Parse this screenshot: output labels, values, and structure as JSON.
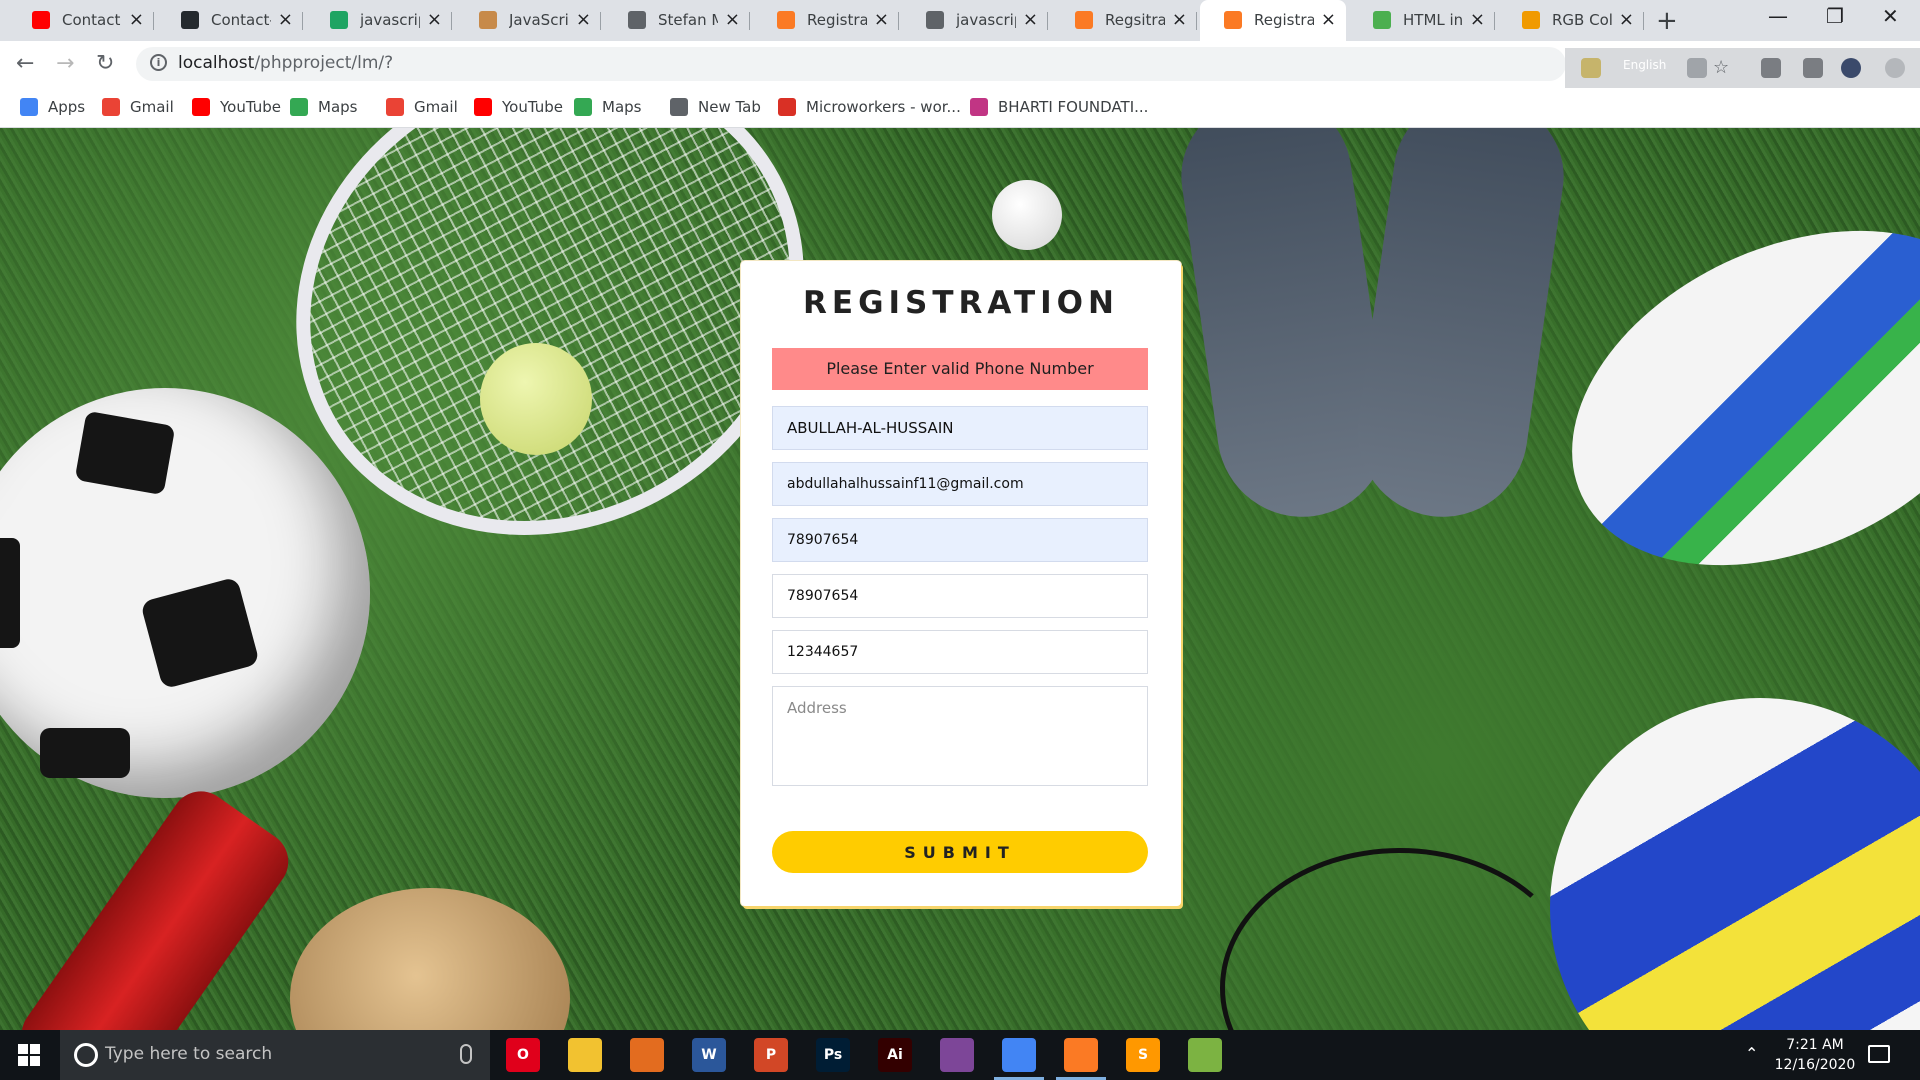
{
  "browser": {
    "tabs": [
      {
        "title": "Contact U",
        "icon": "youtube-icon",
        "color": "#ff0000"
      },
      {
        "title": "Contact-u",
        "icon": "github-icon",
        "color": "#24292e"
      },
      {
        "title": "javascript",
        "icon": "google-drive-icon",
        "color": "#1fa463"
      },
      {
        "title": "JavaScript",
        "icon": "person-avatar-icon",
        "color": "#c78a4a"
      },
      {
        "title": "Stefan Mis",
        "icon": "globe-icon",
        "color": "#5f6368"
      },
      {
        "title": "Registratio",
        "icon": "xampp-icon",
        "color": "#fb7a24"
      },
      {
        "title": "javascript",
        "icon": "globe-icon",
        "color": "#5f6368"
      },
      {
        "title": "Regsitratio",
        "icon": "xampp-icon",
        "color": "#fb7a24"
      },
      {
        "title": "Registratio",
        "icon": "xampp-icon",
        "color": "#fb7a24",
        "active": true
      },
      {
        "title": "HTML inp",
        "icon": "w3schools-icon",
        "color": "#4caf50"
      },
      {
        "title": "RGB Color",
        "icon": "r-logo-icon",
        "color": "#f09a00"
      }
    ],
    "new_tab_label": "+",
    "url_host": "localhost",
    "url_path": "/phpproject/lm/?",
    "extension_language": "English"
  },
  "bookmarks": [
    {
      "label": "Apps",
      "icon": "apps-grid-icon",
      "color": "#4285f4"
    },
    {
      "label": "Gmail",
      "icon": "gmail-icon",
      "color": "#ea4335"
    },
    {
      "label": "YouTube",
      "icon": "youtube-icon",
      "color": "#ff0000"
    },
    {
      "label": "Maps",
      "icon": "maps-pin-icon",
      "color": "#34a853"
    },
    {
      "label": "Gmail",
      "icon": "gmail-icon",
      "color": "#ea4335"
    },
    {
      "label": "YouTube",
      "icon": "youtube-icon",
      "color": "#ff0000"
    },
    {
      "label": "Maps",
      "icon": "maps-pin-icon",
      "color": "#34a853"
    },
    {
      "label": "New Tab",
      "icon": "globe-icon",
      "color": "#5f6368"
    },
    {
      "label": "Microworkers - wor...",
      "icon": "microworkers-icon",
      "color": "#d93025"
    },
    {
      "label": "BHARTI FOUNDATI...",
      "icon": "instagram-icon",
      "color": "#c13584"
    }
  ],
  "form": {
    "title": "REGISTRATION",
    "alert": "Please Enter valid Phone Number",
    "name_value": "ABULLAH-AL-HUSSAIN",
    "email_value": "abdullahalhussainf11@gmail.com",
    "phone_value": "78907654",
    "phone_confirm_value": "78907654",
    "number_value": "12344657",
    "address_placeholder": "Address",
    "submit_label": "SUBMIT",
    "accent_color": "#ffcc00",
    "alert_color": "#ff8a8a"
  },
  "taskbar": {
    "search_placeholder": "Type here to search",
    "apps": [
      {
        "icon": "opera-icon",
        "label": "O",
        "color": "#e0001b"
      },
      {
        "icon": "file-explorer-icon",
        "label": "",
        "color": "#f2c230"
      },
      {
        "icon": "matlab-icon",
        "label": "",
        "color": "#e36c1f"
      },
      {
        "icon": "word-icon",
        "label": "W",
        "color": "#2b579a"
      },
      {
        "icon": "powerpoint-icon",
        "label": "P",
        "color": "#d24726"
      },
      {
        "icon": "photoshop-icon",
        "label": "Ps",
        "color": "#001d34"
      },
      {
        "icon": "illustrator-icon",
        "label": "Ai",
        "color": "#330000"
      },
      {
        "icon": "tor-browser-icon",
        "label": "",
        "color": "#7d4698"
      },
      {
        "icon": "chrome-icon",
        "label": "",
        "color": "#4285f4",
        "running": true
      },
      {
        "icon": "xampp-icon",
        "label": "",
        "color": "#fb7a24",
        "running": true
      },
      {
        "icon": "sublime-text-icon",
        "label": "S",
        "color": "#ff9800"
      },
      {
        "icon": "notepad-plus-icon",
        "label": "",
        "color": "#7cb342"
      }
    ],
    "time": "7:21 AM",
    "date": "12/16/2020"
  }
}
